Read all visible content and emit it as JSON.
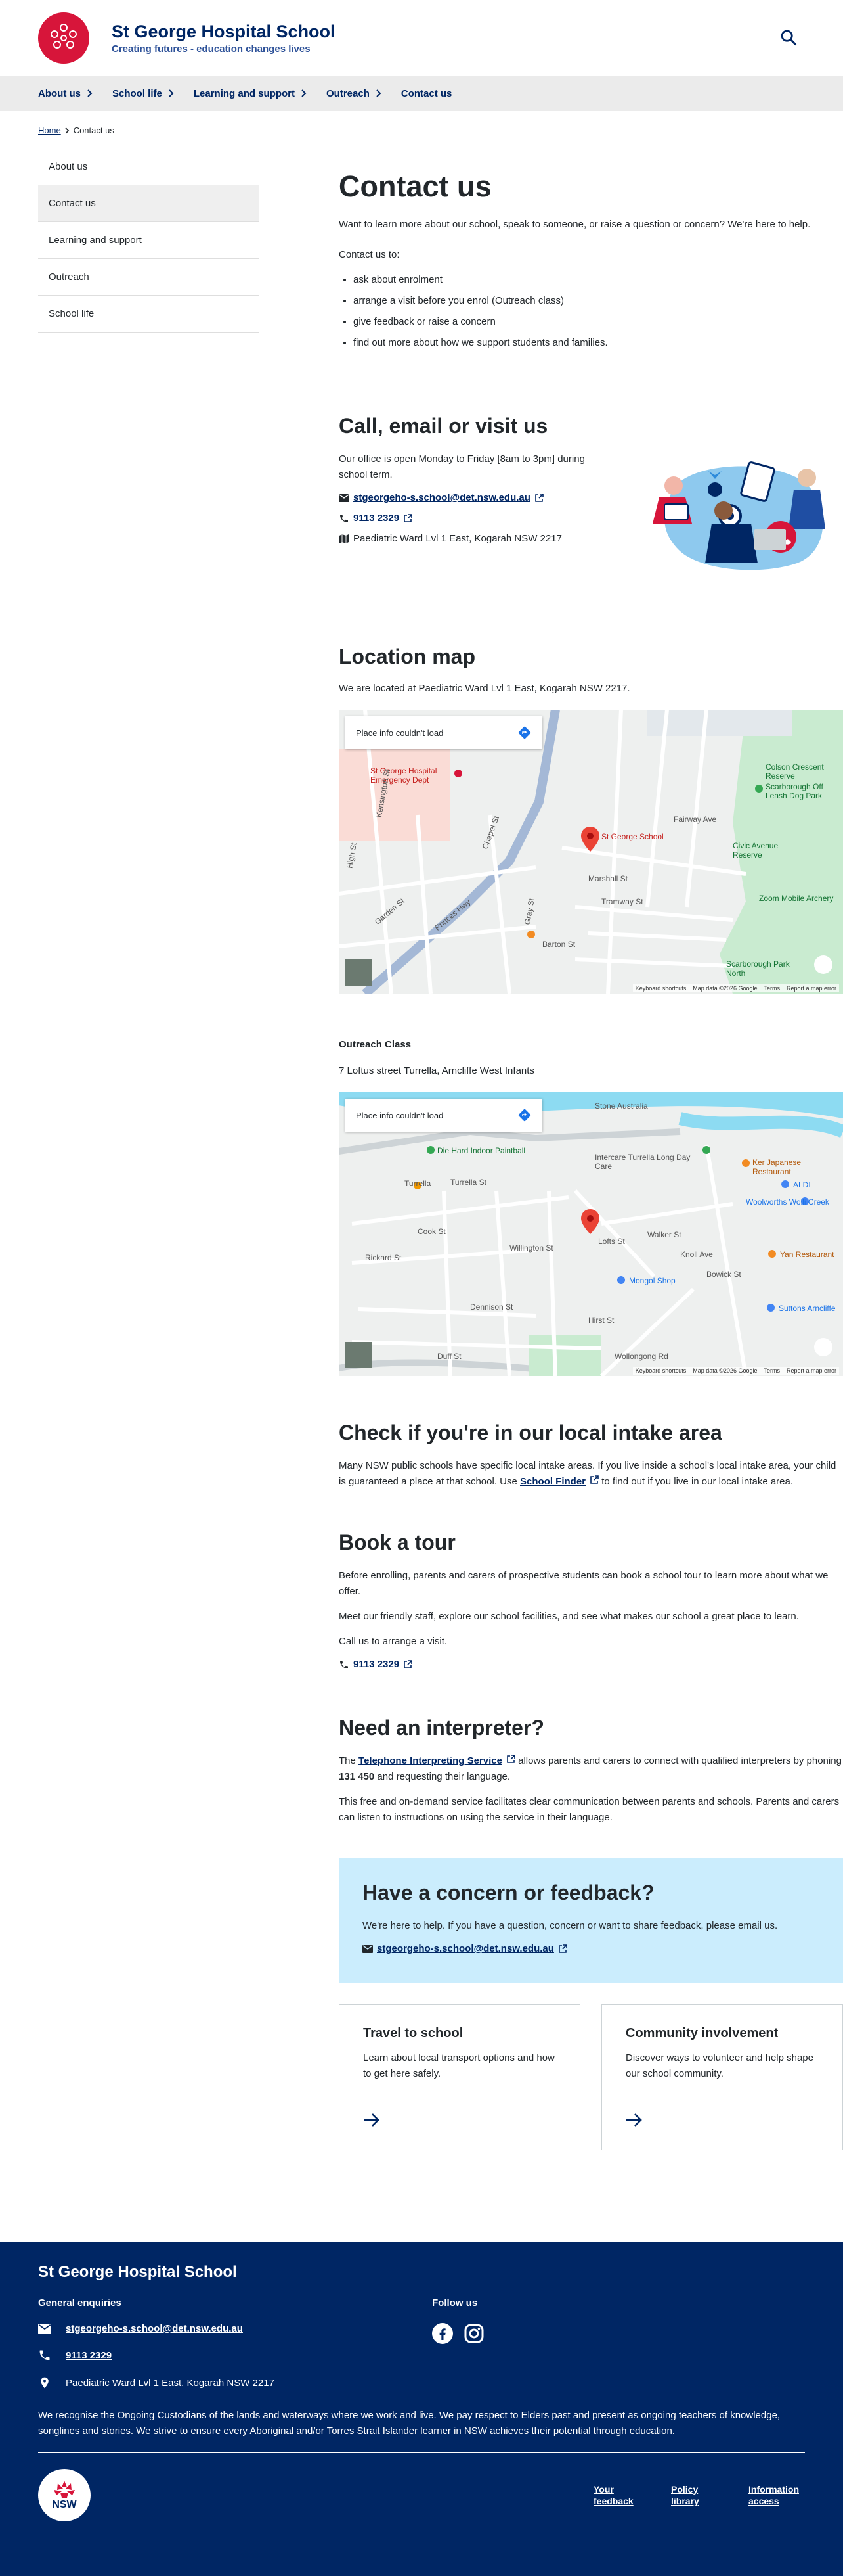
{
  "site": {
    "title": "St George Hospital School",
    "tagline": "Creating futures - education changes lives"
  },
  "nav": {
    "items": [
      "About us",
      "School life",
      "Learning and support",
      "Outreach",
      "Contact us"
    ]
  },
  "breadcrumb": {
    "home": "Home",
    "current": "Contact us"
  },
  "sidenav": {
    "items": [
      "About us",
      "Contact us",
      "Learning and support",
      "Outreach",
      "School life"
    ],
    "active_index": 1
  },
  "page": {
    "title": "Contact us",
    "intro": "Want to learn more about our school, speak to someone, or raise a question or concern? We're here to help.",
    "contact_us_to": "Contact us to:",
    "bullets": [
      "ask about enrolment",
      "arrange a visit before you enrol (Outreach class)",
      "give feedback or raise a concern",
      "find out more about how we support students and families."
    ]
  },
  "call": {
    "heading": "Call, email or visit us",
    "hours": "Our office is open Monday to Friday [8am to 3pm] during school term.",
    "email": "stgeorgeho-s.school@det.nsw.edu.au",
    "phone": "9113 2329",
    "address": "Paediatric Ward Lvl 1 East, Kogarah NSW 2217"
  },
  "location": {
    "heading": "Location map",
    "text": "We are located at Paediatric Ward Lvl 1 East, Kogarah NSW 2217.",
    "map1": {
      "notice": "Place info couldn't load",
      "labels": [
        "St George Hospital Emergency Dept",
        "St George School",
        "Colson Crescent Reserve",
        "Scarborough Off Leash Dog Park",
        "Civic Avenue Reserve",
        "Zoom Mobile Archery",
        "Scarborough Park North",
        "Marshall St",
        "Princes Hwy",
        "Barton St",
        "Tramway St",
        "Fairway Ave",
        "Gray St",
        "Chapel St",
        "Garden St",
        "High St",
        "Kensington St"
      ],
      "credits": [
        "Keyboard shortcuts",
        "Map data ©2026 Google",
        "Terms",
        "Report a map error"
      ]
    },
    "outreach_heading": "Outreach Class",
    "outreach_address": "7 Loftus street Turrella, Arncliffe West Infants",
    "map2": {
      "notice": "Place info couldn't load",
      "labels": [
        "Die Hard Indoor Paintball",
        "Intercare Turrella Long Day Care",
        "Turrella",
        "Turrella St",
        "Ker Japanese Restaurant",
        "ALDI",
        "Woolworths Wolli Creek",
        "Yan Restaurant",
        "Mongol Shop",
        "Suttons Arncliffe",
        "Cook St",
        "Willington St",
        "Walker St",
        "Knoll Ave",
        "Bowick St",
        "Lofts St",
        "Rickard St",
        "Dennison St",
        "Hirst St",
        "Duff St",
        "Wollongong Rd",
        "Stone Australia"
      ],
      "credits": [
        "Keyboard shortcuts",
        "Map data ©2026 Google",
        "Terms",
        "Report a map error"
      ]
    }
  },
  "intake": {
    "heading": "Check if you're in our local intake area",
    "text_before": "Many NSW public schools have specific local intake areas. If you live inside a school's local intake area, your child is guaranteed a place at that school. Use ",
    "link": "School Finder",
    "text_after": " to find out if you live in our local intake area."
  },
  "tour": {
    "heading": "Book a tour",
    "p1": "Before enrolling, parents and carers of prospective students can book a school tour to learn more about what we offer.",
    "p2": "Meet our friendly staff, explore our school facilities, and see what makes our school a great place to learn.",
    "p3": "Call us to arrange a visit.",
    "phone": "9113 2329"
  },
  "interpreter": {
    "heading": "Need an interpreter?",
    "text_before": "The ",
    "link": "Telephone Interpreting Service",
    "text_mid": " allows parents and carers to connect with qualified interpreters by phoning ",
    "number": "131 450",
    "text_after": " and requesting their language.",
    "p2": "This free and on-demand service facilitates clear communication between parents and schools. Parents and carers can listen to instructions on using the service in their language."
  },
  "concern": {
    "heading": "Have a concern or feedback?",
    "text": "We're here to help. If you have a question, concern or want to share feedback, please email us.",
    "email": "stgeorgeho-s.school@det.nsw.edu.au"
  },
  "cards": [
    {
      "title": "Travel to school",
      "text": "Learn about local transport options and how to get here safely."
    },
    {
      "title": "Community involvement",
      "text": "Discover ways to volunteer and help shape our school community."
    }
  ],
  "footer": {
    "title": "St George Hospital School",
    "general": "General enquiries",
    "email": "stgeorgeho-s.school@det.nsw.edu.au",
    "phone": "9113 2329",
    "address": "Paediatric Ward Lvl 1 East, Kogarah NSW 2217",
    "follow": "Follow us",
    "ack": "We recognise the Ongoing Custodians of the lands and waterways where we work and live. We pay respect to Elders past and present as ongoing teachers of knowledge, songlines and stories. We strive to ensure every Aboriginal and/or Torres Strait Islander learner in NSW achieves their potential through education.",
    "logo_text": "NSW",
    "links": [
      "Your feedback",
      "Policy library",
      "Information access"
    ]
  },
  "colors": {
    "brand_blue": "#002664",
    "brand_red": "#d7153a",
    "light_blue": "#cbedfd"
  }
}
